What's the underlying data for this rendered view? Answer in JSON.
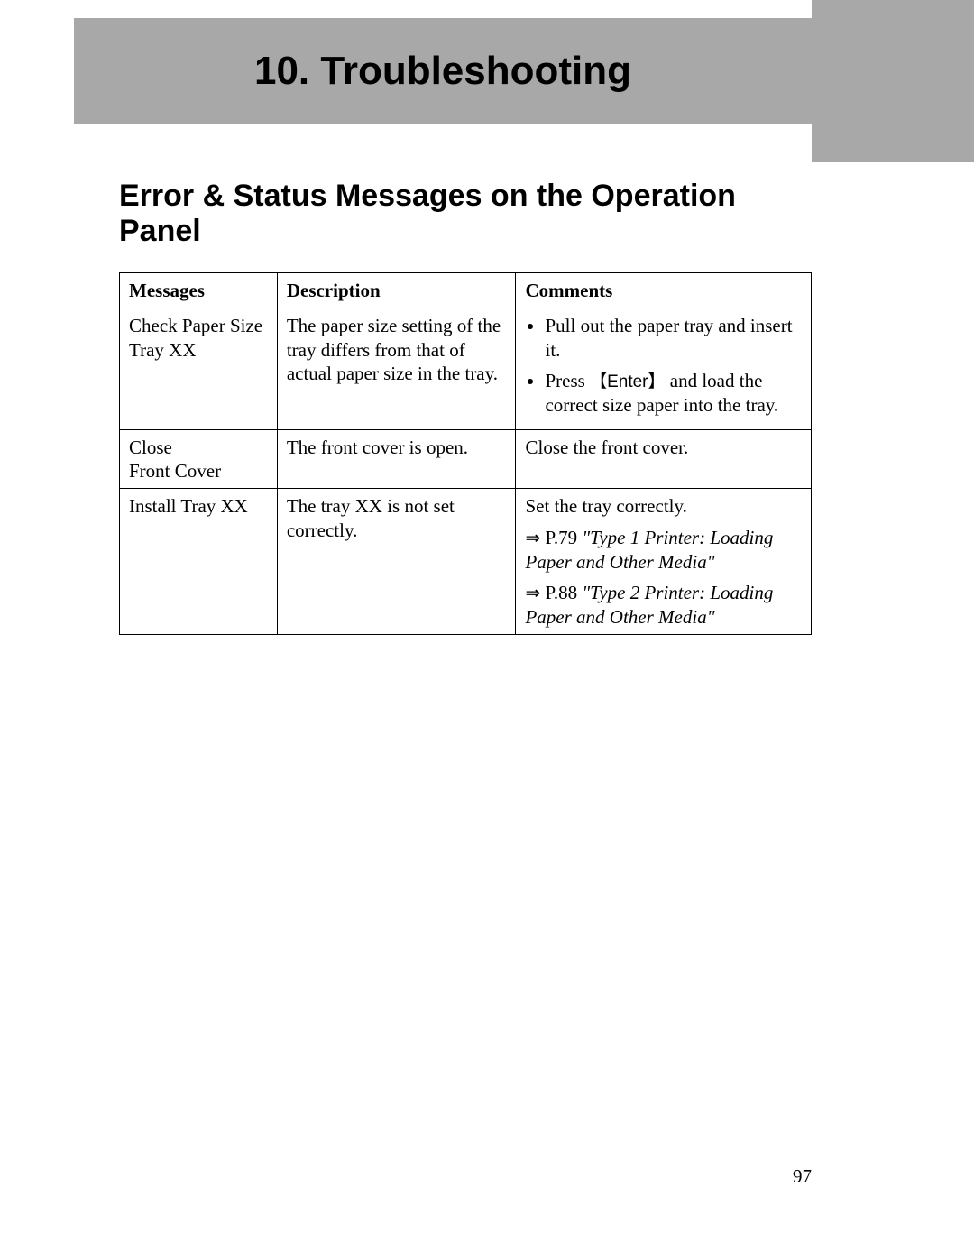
{
  "chapter": {
    "number": "10.",
    "title": "Troubleshooting"
  },
  "section": {
    "title": "Error & Status Messages on the Operation Panel"
  },
  "table": {
    "headers": {
      "col1": "Messages",
      "col2": "Description",
      "col3": "Comments"
    },
    "rows": {
      "r1": {
        "message_l1": "Check Paper Size",
        "message_l2": "Tray XX",
        "description": "The paper size setting of the tray differs from that of actual paper size in the tray.",
        "comments": {
          "bullet1": "Pull out the paper tray and insert it.",
          "bullet2_pre": "Press ",
          "bullet2_key": "Enter",
          "bullet2_post": " and load the correct size paper into the tray."
        }
      },
      "r2": {
        "message_l1": "Close",
        "message_l2": "Front Cover",
        "description": "The front cover is open.",
        "comment": "Close the front cover."
      },
      "r3": {
        "message": "Install Tray XX",
        "description": "The tray XX is not set correctly.",
        "comment_line1": "Set the tray correctly.",
        "ref1_page": "P.79",
        "ref1_title": "\"Type 1 Printer: Loading Paper and Other Media\"",
        "ref2_page": "P.88",
        "ref2_title": "\"Type 2 Printer: Loading Paper and Other Media\""
      }
    }
  },
  "pageNumber": "97"
}
